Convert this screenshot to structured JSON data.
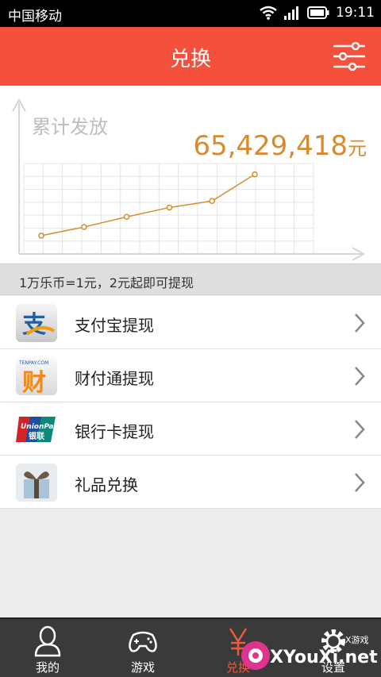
{
  "status_bar": {
    "carrier": "中国移动",
    "time": "19:11"
  },
  "header": {
    "title": "兑换"
  },
  "stats": {
    "label": "累计发放",
    "amount": "65,429,418",
    "unit": "元"
  },
  "chart_data": {
    "type": "line",
    "x": [
      1,
      2,
      3,
      4,
      5,
      6
    ],
    "series": [
      {
        "values": [
          1,
          2.2,
          3.6,
          4.9,
          5.8,
          9.5
        ]
      }
    ],
    "ylim": [
      0,
      11
    ],
    "grid": true,
    "color": "#d88b2e"
  },
  "note": "1万乐币=1元，2元起即可提现",
  "list_items": [
    {
      "label": "支付宝提现",
      "icon": "alipay-icon"
    },
    {
      "label": "财付通提现",
      "icon": "tenpay-icon"
    },
    {
      "label": "银行卡提现",
      "icon": "unionpay-icon"
    },
    {
      "label": "礼品兑换",
      "icon": "gift-icon"
    }
  ],
  "icon_text": {
    "tenpay": "TENPAY.COM",
    "tenpay_char": "财",
    "unionpay": "UnionPay",
    "unionpay_cn": "银联",
    "alipay_char": "支"
  },
  "tabs": [
    {
      "label": "我的",
      "icon": "user-icon"
    },
    {
      "label": "游戏",
      "icon": "gamepad-icon"
    },
    {
      "label": "兑换",
      "icon": "yuan-icon"
    },
    {
      "label": "设置",
      "icon": "gear-icon"
    }
  ],
  "watermark": {
    "text": "XYouXi.net",
    "sub": "X游戏"
  },
  "colors": {
    "header": "#f4503c",
    "accent": "#d88b2e",
    "tab_active": "#f05a3a"
  }
}
